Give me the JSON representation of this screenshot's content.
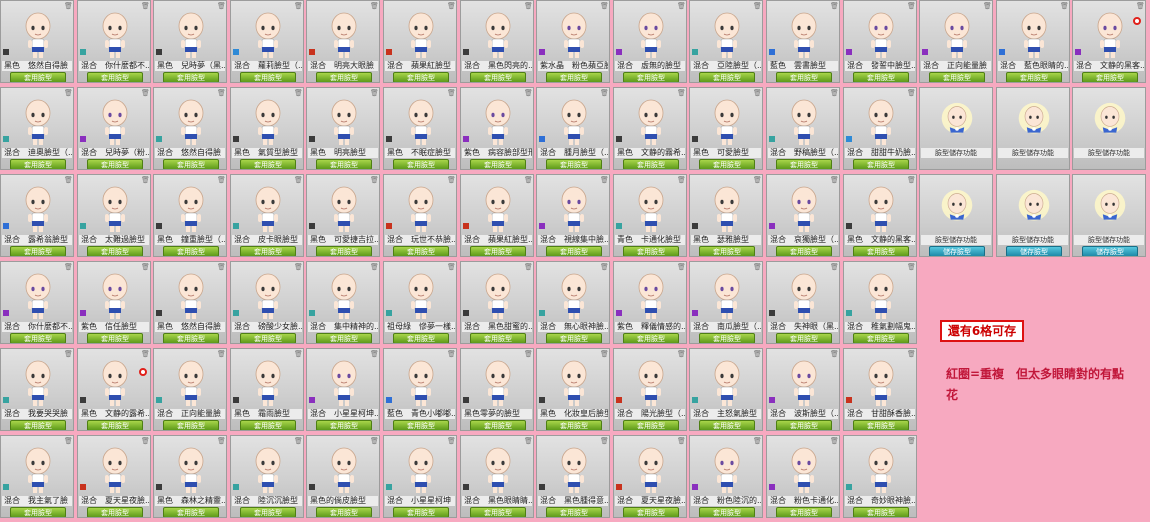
{
  "labels": {
    "apply": "套用臉型",
    "save": "儲存臉型",
    "slot": "臉型儲存功能"
  },
  "notice": "還有6格可存",
  "note": "紅圈=重複　但太多眼睛對的有點花",
  "rows": [
    [
      {
        "name": "黑色　悠然自得臉",
        "swatch": "#3b3b3b"
      },
      {
        "name": "混合　你什麼都不...",
        "swatch": "#37a3a0"
      },
      {
        "name": "黑色　兒時夢（黑...",
        "swatch": "#3b3b3b"
      },
      {
        "name": "混合　蘿莉臉型（...",
        "swatch": "#2e8ad6"
      },
      {
        "name": "混合　明亮大眼臉",
        "swatch": "#c8321d"
      },
      {
        "name": "混合　蘋果紅臉型",
        "swatch": "#c8321d"
      },
      {
        "name": "混合　黑色閃亮的...",
        "swatch": "#3b3b3b"
      },
      {
        "name": "紫水晶　粉色蘋亞臉",
        "swatch": "#8a2fbe"
      },
      {
        "name": "混合　虛無的臉型",
        "swatch": "#8a2fbe"
      },
      {
        "name": "混合　亞陸臉型（...",
        "swatch": "#37a3a0"
      },
      {
        "name": "藍色　雲書臉型",
        "swatch": "#2e6fd6"
      },
      {
        "name": "混合　發誓中臉型...",
        "swatch": "#8a2fbe"
      },
      {
        "name": "混合　正向能量臉",
        "swatch": "#8a2fbe"
      },
      {
        "name": "混合　藍色眼睛的...",
        "swatch": "#2e6fd6"
      },
      {
        "name": "混合　文静的黑客...",
        "swatch": "#8a2fbe"
      }
    ],
    [
      {
        "name": "混合　迪奧臉型（...",
        "swatch": "#37a3a0"
      },
      {
        "name": "混合　兒時夢（粉...",
        "swatch": "#8a2fbe"
      },
      {
        "name": "混合　悠然自得臉",
        "swatch": "#37a3a0"
      },
      {
        "name": "黑色　氣質型臉型",
        "swatch": "#3b3b3b"
      },
      {
        "name": "黑色　明亮臉型",
        "swatch": "#3b3b3b"
      },
      {
        "name": "黑色　不眠症臉型",
        "swatch": "#3b3b3b"
      },
      {
        "name": "紫色　病容臉部型形",
        "swatch": "#8a2fbe"
      },
      {
        "name": "混合　腫月臉型（...",
        "swatch": "#2e6fd6"
      },
      {
        "name": "黑色　文静的霧希...",
        "swatch": "#3b3b3b"
      },
      {
        "name": "黑色　可愛臉型",
        "swatch": "#3b3b3b"
      },
      {
        "name": "混合　野稿臉型（...",
        "swatch": "#37a3a0"
      },
      {
        "name": "混合　甜甜牛奶臉...",
        "swatch": "#2e8ad6"
      },
      {
        "slot": true
      },
      {
        "slot": true
      },
      {
        "slot": true
      }
    ],
    [
      {
        "name": "混合　露希翁臉型",
        "swatch": "#2e6fd6"
      },
      {
        "name": "混合　太難過臉型",
        "swatch": "#37a3a0"
      },
      {
        "name": "黑色　鐘重臉型（...",
        "swatch": "#3b3b3b"
      },
      {
        "name": "混合　皮卡眼臉型",
        "swatch": "#37a3a0"
      },
      {
        "name": "黑色　可愛捷吉拉...",
        "swatch": "#3b3b3b"
      },
      {
        "name": "混合　玩世不恭臉...",
        "swatch": "#c8321d"
      },
      {
        "name": "混合　蘋果紅臉型...",
        "swatch": "#c8321d"
      },
      {
        "name": "混合　視線集中臉...",
        "swatch": "#8a2fbe"
      },
      {
        "name": "青色　卡通化臉型",
        "swatch": "#37a3a0"
      },
      {
        "name": "黑色　瑟雅臉型",
        "swatch": "#3b3b3b"
      },
      {
        "name": "混合　哀獨臉型（...",
        "swatch": "#8a2fbe"
      },
      {
        "name": "黑色　文静的黑客...",
        "swatch": "#3b3b3b"
      },
      {
        "slot": true,
        "save": true
      },
      {
        "slot": true,
        "save": true
      },
      {
        "slot": true,
        "save": true
      }
    ],
    [
      {
        "name": "混合　你什麼都不...",
        "swatch": "#8a2fbe"
      },
      {
        "name": "紫色　信任臉型",
        "swatch": "#8a2fbe"
      },
      {
        "name": "黑色　悠然自得臉",
        "swatch": "#3b3b3b"
      },
      {
        "name": "混合　磅酸少女臉...",
        "swatch": "#37a3a0"
      },
      {
        "name": "混合　集中精神的...",
        "swatch": "#37a3a0"
      },
      {
        "name": "祖母綠　慘夢一樣...",
        "swatch": "#37a3a0"
      },
      {
        "name": "混合　黑色甜蜜的...",
        "swatch": "#3b3b3b"
      },
      {
        "name": "混合　無心眼神臉...",
        "swatch": "#37a3a0"
      },
      {
        "name": "紫色　釋儀情感的...",
        "swatch": "#8a2fbe"
      },
      {
        "name": "混合　南瓜臉型（...",
        "swatch": "#8a2fbe"
      },
      {
        "name": "混合　失神眼（黑...",
        "swatch": "#3b3b3b"
      },
      {
        "name": "混合　稚氣劃幅鬼...",
        "swatch": "#37a3a0"
      },
      {
        "empty": true
      },
      {
        "empty": true
      },
      {
        "empty": true
      }
    ],
    [
      {
        "name": "混合　我要哭哭臉",
        "swatch": "#37a3a0"
      },
      {
        "name": "黑色　文静的露希...",
        "swatch": "#3b3b3b",
        "marked": true
      },
      {
        "name": "混合　正向能量臉",
        "swatch": "#37a3a0"
      },
      {
        "name": "黑色　霜雨臉型",
        "swatch": "#3b3b3b"
      },
      {
        "name": "混合　小星星柯坤...",
        "swatch": "#8a2fbe"
      },
      {
        "name": "藍色　青色小嘟嘟...",
        "swatch": "#2e6fd6"
      },
      {
        "name": "黑色零夢的臉型",
        "swatch": "#3b3b3b"
      },
      {
        "name": "黑色　化妝皇后臉型",
        "swatch": "#3b3b3b"
      },
      {
        "name": "混合　陽光臉型（...",
        "swatch": "#c8321d"
      },
      {
        "name": "混合　主怒氣臉型",
        "swatch": "#37a3a0"
      },
      {
        "name": "混合　波斯臉型（...",
        "swatch": "#8a2fbe"
      },
      {
        "name": "混合　甘甜酥香臉...",
        "swatch": "#c8321d"
      },
      {
        "empty": true
      },
      {
        "empty": true
      },
      {
        "empty": true
      }
    ],
    [
      {
        "name": "混合　我主氣了臉",
        "swatch": "#37a3a0"
      },
      {
        "name": "混合　夏天星夜臉...",
        "swatch": "#c8321d"
      },
      {
        "name": "黑色　森林之精靈...",
        "swatch": "#3b3b3b"
      },
      {
        "name": "混合　陸沉沉臉型",
        "swatch": "#37a3a0"
      },
      {
        "name": "黑色的倘皮臉型",
        "swatch": "#3b3b3b"
      },
      {
        "name": "混合　小星星柯坤",
        "swatch": "#37a3a0"
      },
      {
        "name": "混合　黑色眼睛睛...",
        "swatch": "#3b3b3b"
      },
      {
        "name": "混合　黑色腫得意...",
        "swatch": "#3b3b3b"
      },
      {
        "name": "混合　夏天星夜臉...",
        "swatch": "#c8321d"
      },
      {
        "name": "混合　粉色陸沉的...",
        "swatch": "#8a2fbe"
      },
      {
        "name": "混合　粉色卡通化...",
        "swatch": "#8a2fbe"
      },
      {
        "name": "混合　奇妙眼神臉...",
        "swatch": "#37a3a0"
      },
      {
        "empty": true
      },
      {
        "empty": true
      },
      {
        "empty": true
      }
    ]
  ]
}
